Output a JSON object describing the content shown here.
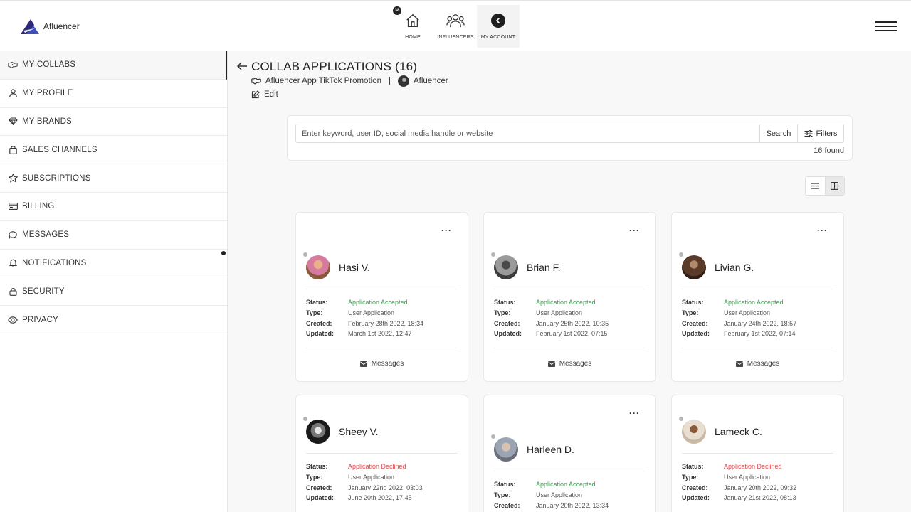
{
  "brand": {
    "name": "Afluencer"
  },
  "topnav": {
    "badge": "38",
    "items": [
      {
        "label": "HOME",
        "icon": "home-icon"
      },
      {
        "label": "INFLUENCERS",
        "icon": "users-icon"
      },
      {
        "label": "MY ACCOUNT",
        "icon": "chevron-left-circle-icon",
        "active": true
      }
    ]
  },
  "sidebar": {
    "items": [
      {
        "label": "MY COLLABS",
        "icon": "handshake-icon",
        "active": true
      },
      {
        "label": "MY PROFILE",
        "icon": "user-icon"
      },
      {
        "label": "MY BRANDS",
        "icon": "diamond-icon"
      },
      {
        "label": "SALES CHANNELS",
        "icon": "shopping-bag-icon"
      },
      {
        "label": "SUBSCRIPTIONS",
        "icon": "star-icon"
      },
      {
        "label": "BILLING",
        "icon": "credit-card-icon"
      },
      {
        "label": "MESSAGES",
        "icon": "chat-bubble-icon"
      },
      {
        "label": "NOTIFICATIONS",
        "icon": "bell-icon"
      },
      {
        "label": "SECURITY",
        "icon": "lock-icon"
      },
      {
        "label": "PRIVACY",
        "icon": "eye-icon"
      }
    ]
  },
  "page": {
    "title": "COLLAB APPLICATIONS (16)",
    "collab_name": "Afluencer App TikTok Promotion",
    "separator": "|",
    "brand_name": "Afluencer",
    "edit_label": "Edit"
  },
  "search": {
    "placeholder": "Enter keyword, user ID, social media handle or website",
    "value": "",
    "search_label": "Search",
    "filters_label": "Filters",
    "found_text": "16 found"
  },
  "labels": {
    "status": "Status:",
    "type": "Type:",
    "created": "Created:",
    "updated": "Updated:",
    "messages": "Messages",
    "more": "···"
  },
  "cards": [
    {
      "name": "Hasi V.",
      "status": "Application Accepted",
      "type": "User Application",
      "created": "February 28th 2022, 18:34",
      "updated": "March 1st 2022, 12:47"
    },
    {
      "name": "Brian F.",
      "status": "Application Accepted",
      "type": "User Application",
      "created": "January 25th 2022, 10:35",
      "updated": "February 1st 2022, 07:15"
    },
    {
      "name": "Livian G.",
      "status": "Application Accepted",
      "type": "User Application",
      "created": "January 24th 2022, 18:57",
      "updated": "February 1st 2022, 07:14"
    },
    {
      "name": "Sheey V.",
      "status": "Application Declined",
      "type": "User Application",
      "created": "January 22nd 2022, 03:03",
      "updated": "June 20th 2022, 17:45"
    },
    {
      "name": "Harleen D.",
      "status": "Application Accepted",
      "type": "User Application",
      "created": "January 20th 2022, 13:34",
      "updated": ""
    },
    {
      "name": "Lameck C.",
      "status": "Application Declined",
      "type": "User Application",
      "created": "January 20th 2022, 09:32",
      "updated": "January 21st 2022, 08:13"
    }
  ],
  "colors": {
    "accepted": "#2ea84a",
    "declined": "#e0484b",
    "brand": "#2d2a7a"
  }
}
